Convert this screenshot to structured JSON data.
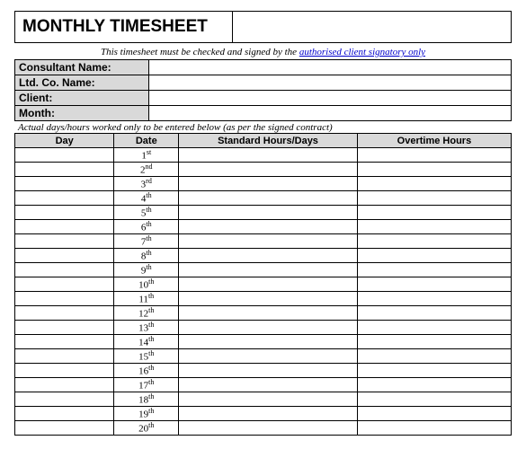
{
  "title": "MONTHLY TIMESHEET",
  "notice_prefix": "This timesheet must be checked and signed by the ",
  "notice_link": "authorised client signatory only",
  "fields": {
    "consultant_label": "Consultant Name:",
    "consultant_value": "",
    "company_label": "Ltd. Co. Name:",
    "company_value": "",
    "client_label": "Client:",
    "client_value": "",
    "month_label": "Month:",
    "month_value": ""
  },
  "instruction": "Actual days/hours worked only to be entered below (as per the signed contract)",
  "columns": {
    "day": "Day",
    "date": "Date",
    "std": "Standard Hours/Days",
    "ot": "Overtime Hours"
  },
  "rows": [
    {
      "day": "",
      "date_num": "1",
      "date_suffix": "st",
      "std": "",
      "ot": ""
    },
    {
      "day": "",
      "date_num": "2",
      "date_suffix": "nd",
      "std": "",
      "ot": ""
    },
    {
      "day": "",
      "date_num": "3",
      "date_suffix": "rd",
      "std": "",
      "ot": ""
    },
    {
      "day": "",
      "date_num": "4",
      "date_suffix": "th",
      "std": "",
      "ot": ""
    },
    {
      "day": "",
      "date_num": "5",
      "date_suffix": "th",
      "std": "",
      "ot": ""
    },
    {
      "day": "",
      "date_num": "6",
      "date_suffix": "th",
      "std": "",
      "ot": ""
    },
    {
      "day": "",
      "date_num": "7",
      "date_suffix": "th",
      "std": "",
      "ot": ""
    },
    {
      "day": "",
      "date_num": "8",
      "date_suffix": "th",
      "std": "",
      "ot": ""
    },
    {
      "day": "",
      "date_num": "9",
      "date_suffix": "th",
      "std": "",
      "ot": ""
    },
    {
      "day": "",
      "date_num": "10",
      "date_suffix": "th",
      "std": "",
      "ot": ""
    },
    {
      "day": "",
      "date_num": "11",
      "date_suffix": "th",
      "std": "",
      "ot": ""
    },
    {
      "day": "",
      "date_num": "12",
      "date_suffix": "th",
      "std": "",
      "ot": ""
    },
    {
      "day": "",
      "date_num": "13",
      "date_suffix": "th",
      "std": "",
      "ot": ""
    },
    {
      "day": "",
      "date_num": "14",
      "date_suffix": "th",
      "std": "",
      "ot": ""
    },
    {
      "day": "",
      "date_num": "15",
      "date_suffix": "th",
      "std": "",
      "ot": ""
    },
    {
      "day": "",
      "date_num": "16",
      "date_suffix": "th",
      "std": "",
      "ot": ""
    },
    {
      "day": "",
      "date_num": "17",
      "date_suffix": "th",
      "std": "",
      "ot": ""
    },
    {
      "day": "",
      "date_num": "18",
      "date_suffix": "th",
      "std": "",
      "ot": ""
    },
    {
      "day": "",
      "date_num": "19",
      "date_suffix": "th",
      "std": "",
      "ot": ""
    },
    {
      "day": "",
      "date_num": "20",
      "date_suffix": "th",
      "std": "",
      "ot": ""
    }
  ]
}
